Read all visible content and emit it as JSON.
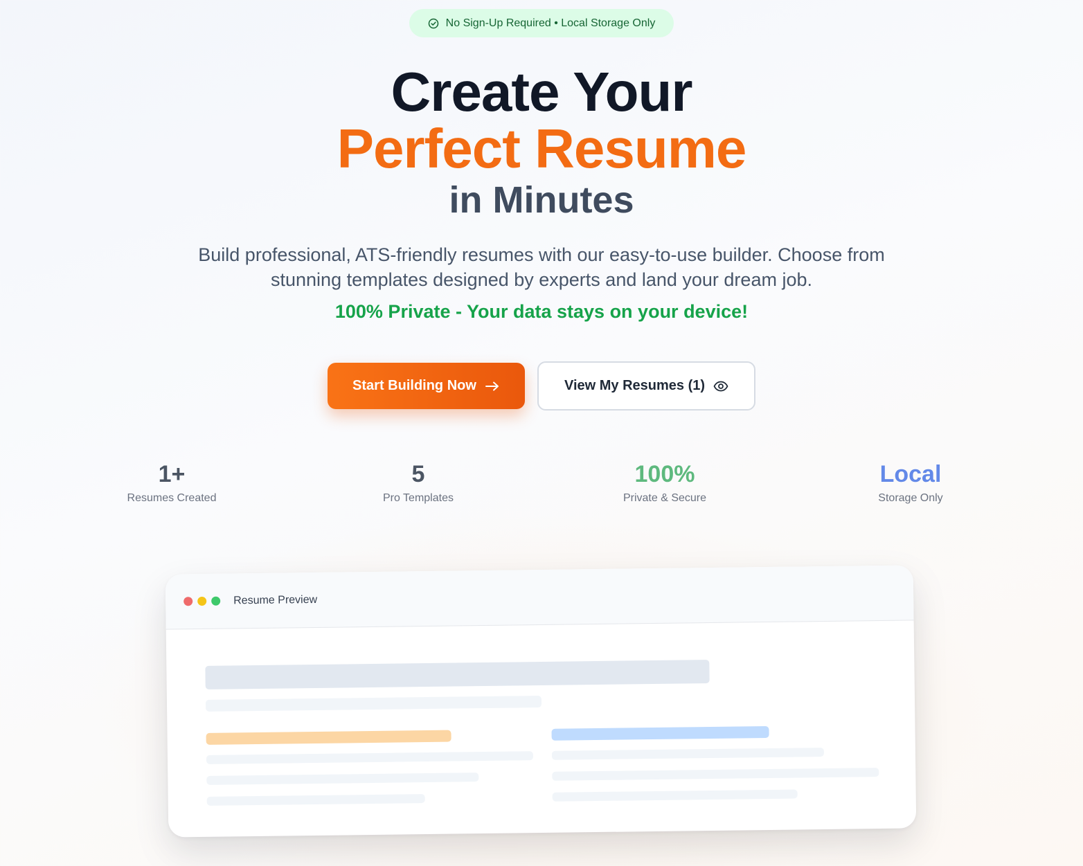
{
  "badge": {
    "icon": "check-circle-icon",
    "text": "No Sign-Up Required • Local Storage Only"
  },
  "hero": {
    "line1": "Create Your",
    "line2": "Perfect Resume",
    "line3": "in Minutes",
    "subtitle": "Build professional, ATS-friendly resumes with our easy-to-use builder. Choose from stunning templates designed by experts and land your dream job.",
    "private_note": "100% Private - Your data stays on your device!"
  },
  "buttons": {
    "start_label": "Start Building Now",
    "start_icon": "arrow-right-icon",
    "view_label": "View My Resumes (1)",
    "view_icon": "eye-icon"
  },
  "stats": [
    {
      "value": "1+",
      "label": "Resumes Created",
      "color": "#4b5563"
    },
    {
      "value": "5",
      "label": "Pro Templates",
      "color": "#4b5563"
    },
    {
      "value": "100%",
      "label": "Private & Secure",
      "color": "#5eb97e"
    },
    {
      "value": "Local",
      "label": "Storage Only",
      "color": "#6389e8"
    }
  ],
  "preview": {
    "title": "Resume Preview",
    "dot_colors": [
      "#ef6b6b",
      "#f5c518",
      "#3ec96b"
    ],
    "accent_left": "#fcd6a4",
    "accent_right": "#bfdbfe"
  },
  "colors": {
    "brand": "#f36c13",
    "private_green": "#16a34a",
    "badge_bg": "#dcfce7"
  }
}
